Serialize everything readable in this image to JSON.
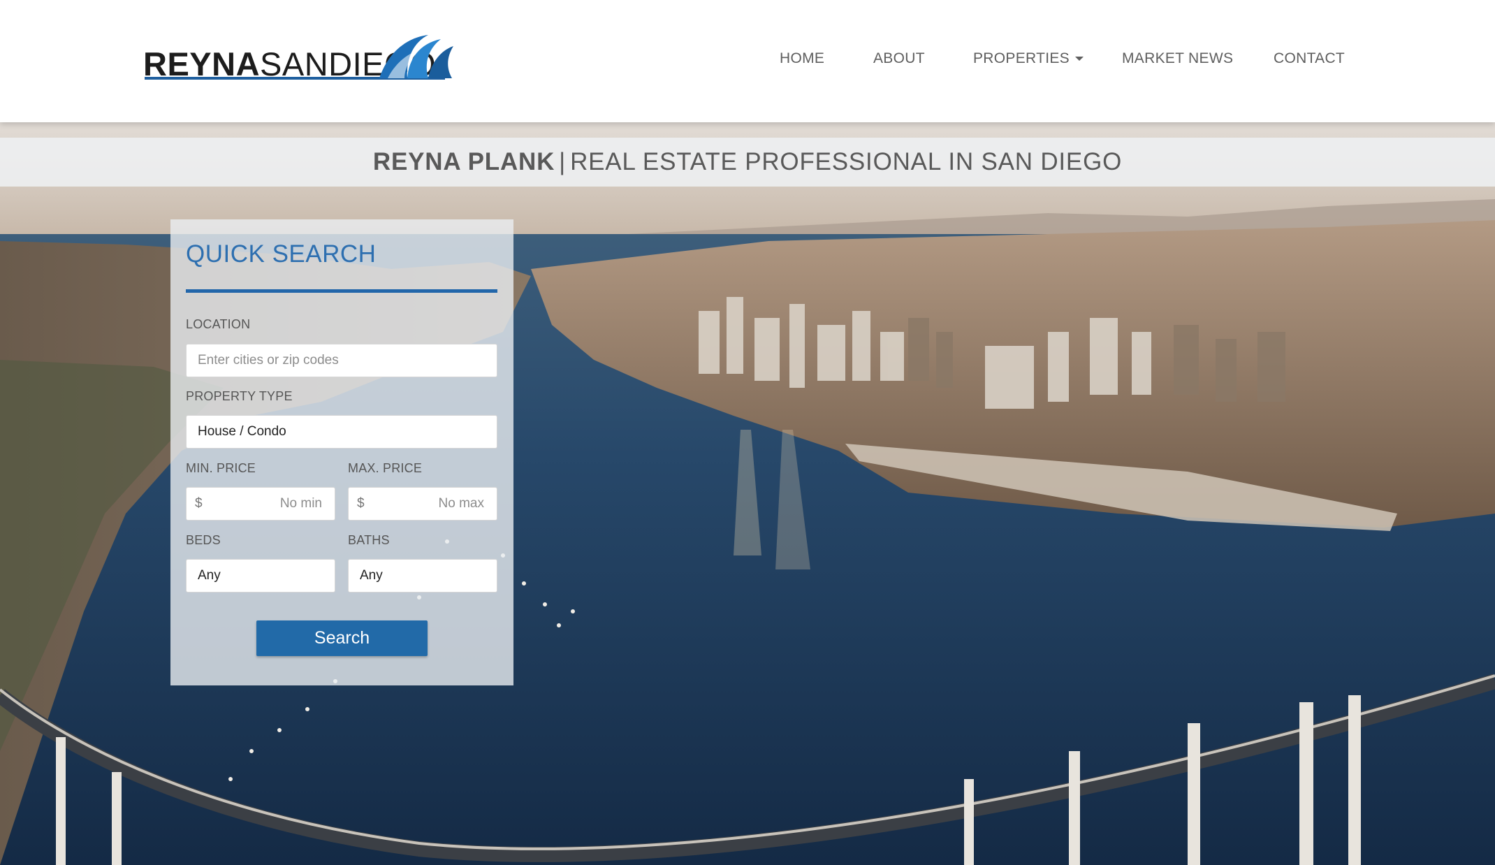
{
  "header": {
    "logo": {
      "bold": "REYNA",
      "light": "SANDIEGO"
    },
    "nav": [
      {
        "label": "HOME"
      },
      {
        "label": "ABOUT"
      },
      {
        "label": "PROPERTIES"
      },
      {
        "label": "MARKET NEWS"
      },
      {
        "label": "CONTACT"
      }
    ]
  },
  "hero": {
    "tagline_name": "REYNA PLANK",
    "tagline_sep": "|",
    "tagline_role": "REAL ESTATE PROFESSIONAL IN SAN DIEGO"
  },
  "quick_search": {
    "title": "QUICK SEARCH",
    "location": {
      "label": "LOCATION",
      "placeholder": "Enter cities or zip codes"
    },
    "property_type": {
      "label": "PROPERTY TYPE",
      "value": "House / Condo"
    },
    "min_price": {
      "label": "MIN. PRICE",
      "prefix": "$",
      "placeholder": "No min"
    },
    "max_price": {
      "label": "MAX. PRICE",
      "prefix": "$",
      "placeholder": "No max"
    },
    "beds": {
      "label": "BEDS",
      "value": "Any"
    },
    "baths": {
      "label": "BATHS",
      "value": "Any"
    },
    "search_button": "Search"
  },
  "colors": {
    "accent": "#226aa8",
    "title_blue": "#2d6fb0",
    "nav_text": "#5e5e5e"
  }
}
